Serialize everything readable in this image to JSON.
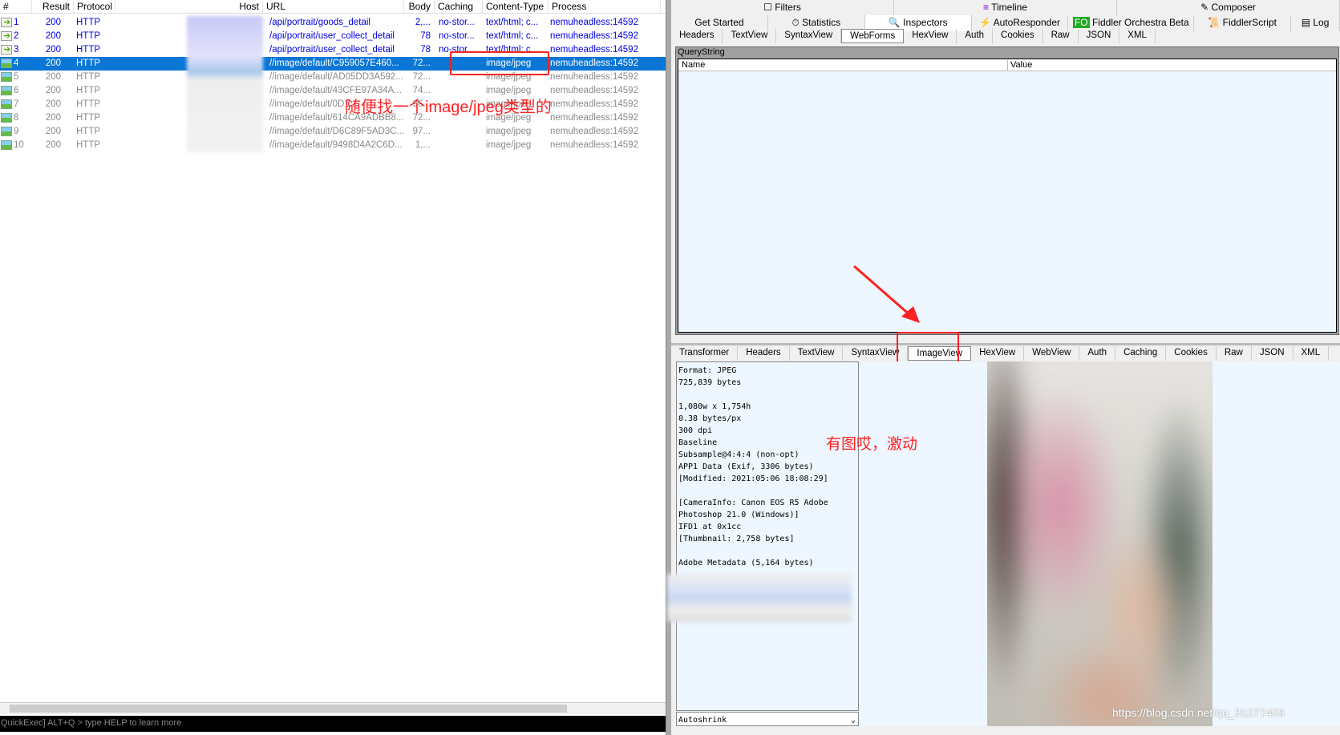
{
  "sessions": {
    "columns": [
      "#",
      "Result",
      "Protocol",
      "Host",
      "URL",
      "Body",
      "Caching",
      "Content-Type",
      "Process"
    ],
    "rows": [
      {
        "id": "1",
        "result": "200",
        "protocol": "HTTP",
        "url": "/api/portrait/goods_detail",
        "body": "2,...",
        "caching": "no-stor...",
        "type": "text/html; c...",
        "process": "nemuheadless:14592",
        "icon": "arrow-icon",
        "style": "blue"
      },
      {
        "id": "2",
        "result": "200",
        "protocol": "HTTP",
        "url": "/api/portrait/user_collect_detail",
        "body": "78",
        "caching": "no-stor...",
        "type": "text/html; c...",
        "process": "nemuheadless:14592",
        "icon": "arrow-icon",
        "style": "blue"
      },
      {
        "id": "3",
        "result": "200",
        "protocol": "HTTP",
        "url": "/api/portrait/user_collect_detail",
        "body": "78",
        "caching": "no-stor...",
        "type": "text/html; c...",
        "process": "nemuheadless:14592",
        "icon": "arrow-icon",
        "style": "blue"
      },
      {
        "id": "4",
        "result": "200",
        "protocol": "HTTP",
        "url": "//image/default/C959057E460...",
        "body": "72...",
        "caching": "",
        "type": "image/jpeg",
        "process": "nemuheadless:14592",
        "icon": "image-icon",
        "style": "sel"
      },
      {
        "id": "5",
        "result": "200",
        "protocol": "HTTP",
        "url": "//image/default/AD05DD3A592...",
        "body": "72...",
        "caching": "",
        "type": "image/jpeg",
        "process": "nemuheadless:14592",
        "icon": "image-icon",
        "style": "gray"
      },
      {
        "id": "6",
        "result": "200",
        "protocol": "HTTP",
        "url": "//image/default/43CFE97A34A...",
        "body": "74...",
        "caching": "",
        "type": "image/jpeg",
        "process": "nemuheadless:14592",
        "icon": "image-icon",
        "style": "gray"
      },
      {
        "id": "7",
        "result": "200",
        "protocol": "HTTP",
        "url": "//image/default/0D1...",
        "body": "96...",
        "caching": "",
        "type": "image/jpeg",
        "process": "nemuheadless:14592",
        "icon": "image-icon",
        "style": "gray"
      },
      {
        "id": "8",
        "result": "200",
        "protocol": "HTTP",
        "url": "//image/default/614CA9ADBB8...",
        "body": "72...",
        "caching": "",
        "type": "image/jpeg",
        "process": "nemuheadless:14592",
        "icon": "image-icon",
        "style": "gray"
      },
      {
        "id": "9",
        "result": "200",
        "protocol": "HTTP",
        "url": "//image/default/D6C89F5AD3C...",
        "body": "97...",
        "caching": "",
        "type": "image/jpeg",
        "process": "nemuheadless:14592",
        "icon": "image-icon",
        "style": "gray"
      },
      {
        "id": "10",
        "result": "200",
        "protocol": "HTTP",
        "url": "//image/default/9498D4A2C6D...",
        "body": "1,...",
        "caching": "",
        "type": "image/jpeg",
        "process": "nemuheadless:14592",
        "icon": "image-icon",
        "style": "gray"
      }
    ],
    "annotation": "随便找一个image/jpeg类型的"
  },
  "quickexec": "QuickExec] ALT+Q > type HELP to learn more",
  "top_tabs_row1": [
    "Filters",
    "Timeline",
    "Composer"
  ],
  "top_tabs_row2": [
    "Get Started",
    "Statistics",
    "Inspectors",
    "AutoResponder",
    "Fiddler Orchestra Beta",
    "FiddlerScript",
    "Log"
  ],
  "request_tabs": [
    "Headers",
    "TextView",
    "SyntaxView",
    "WebForms",
    "HexView",
    "Auth",
    "Cookies",
    "Raw",
    "JSON",
    "XML"
  ],
  "request_active": "WebForms",
  "querystring": {
    "title": "QueryString",
    "name_col": "Name",
    "value_col": "Value"
  },
  "response_tabs": [
    "Transformer",
    "Headers",
    "TextView",
    "SyntaxView",
    "ImageView",
    "HexView",
    "WebView",
    "Auth",
    "Caching",
    "Cookies",
    "Raw",
    "JSON",
    "XML"
  ],
  "response_active": "ImageView",
  "image_info": "Format: JPEG\n725,839 bytes\n\n1,080w x 1,754h\n0.38 bytes/px\n300 dpi\nBaseline\nSubsample@4:4:4 (non-opt)\nAPP1 Data (Exif, 3306 bytes)\n[Modified: 2021:05:06 18:08:29]\n\n[CameraInfo: Canon EOS R5 Adobe\nPhotoshop 21.0 (Windows)]\nIFD1 at 0x1cc\n[Thumbnail: 2,758 bytes]\n\nAdobe Metadata (5,164 bytes)",
  "autoshrink": "Autoshrink",
  "image_annotation": "有图哎，激动",
  "watermark": "https://blog.csdn.net/qq_31277409",
  "colors": {
    "selection": "#0a76d6",
    "annotation": "#ff2222",
    "link": "#0000e0"
  }
}
